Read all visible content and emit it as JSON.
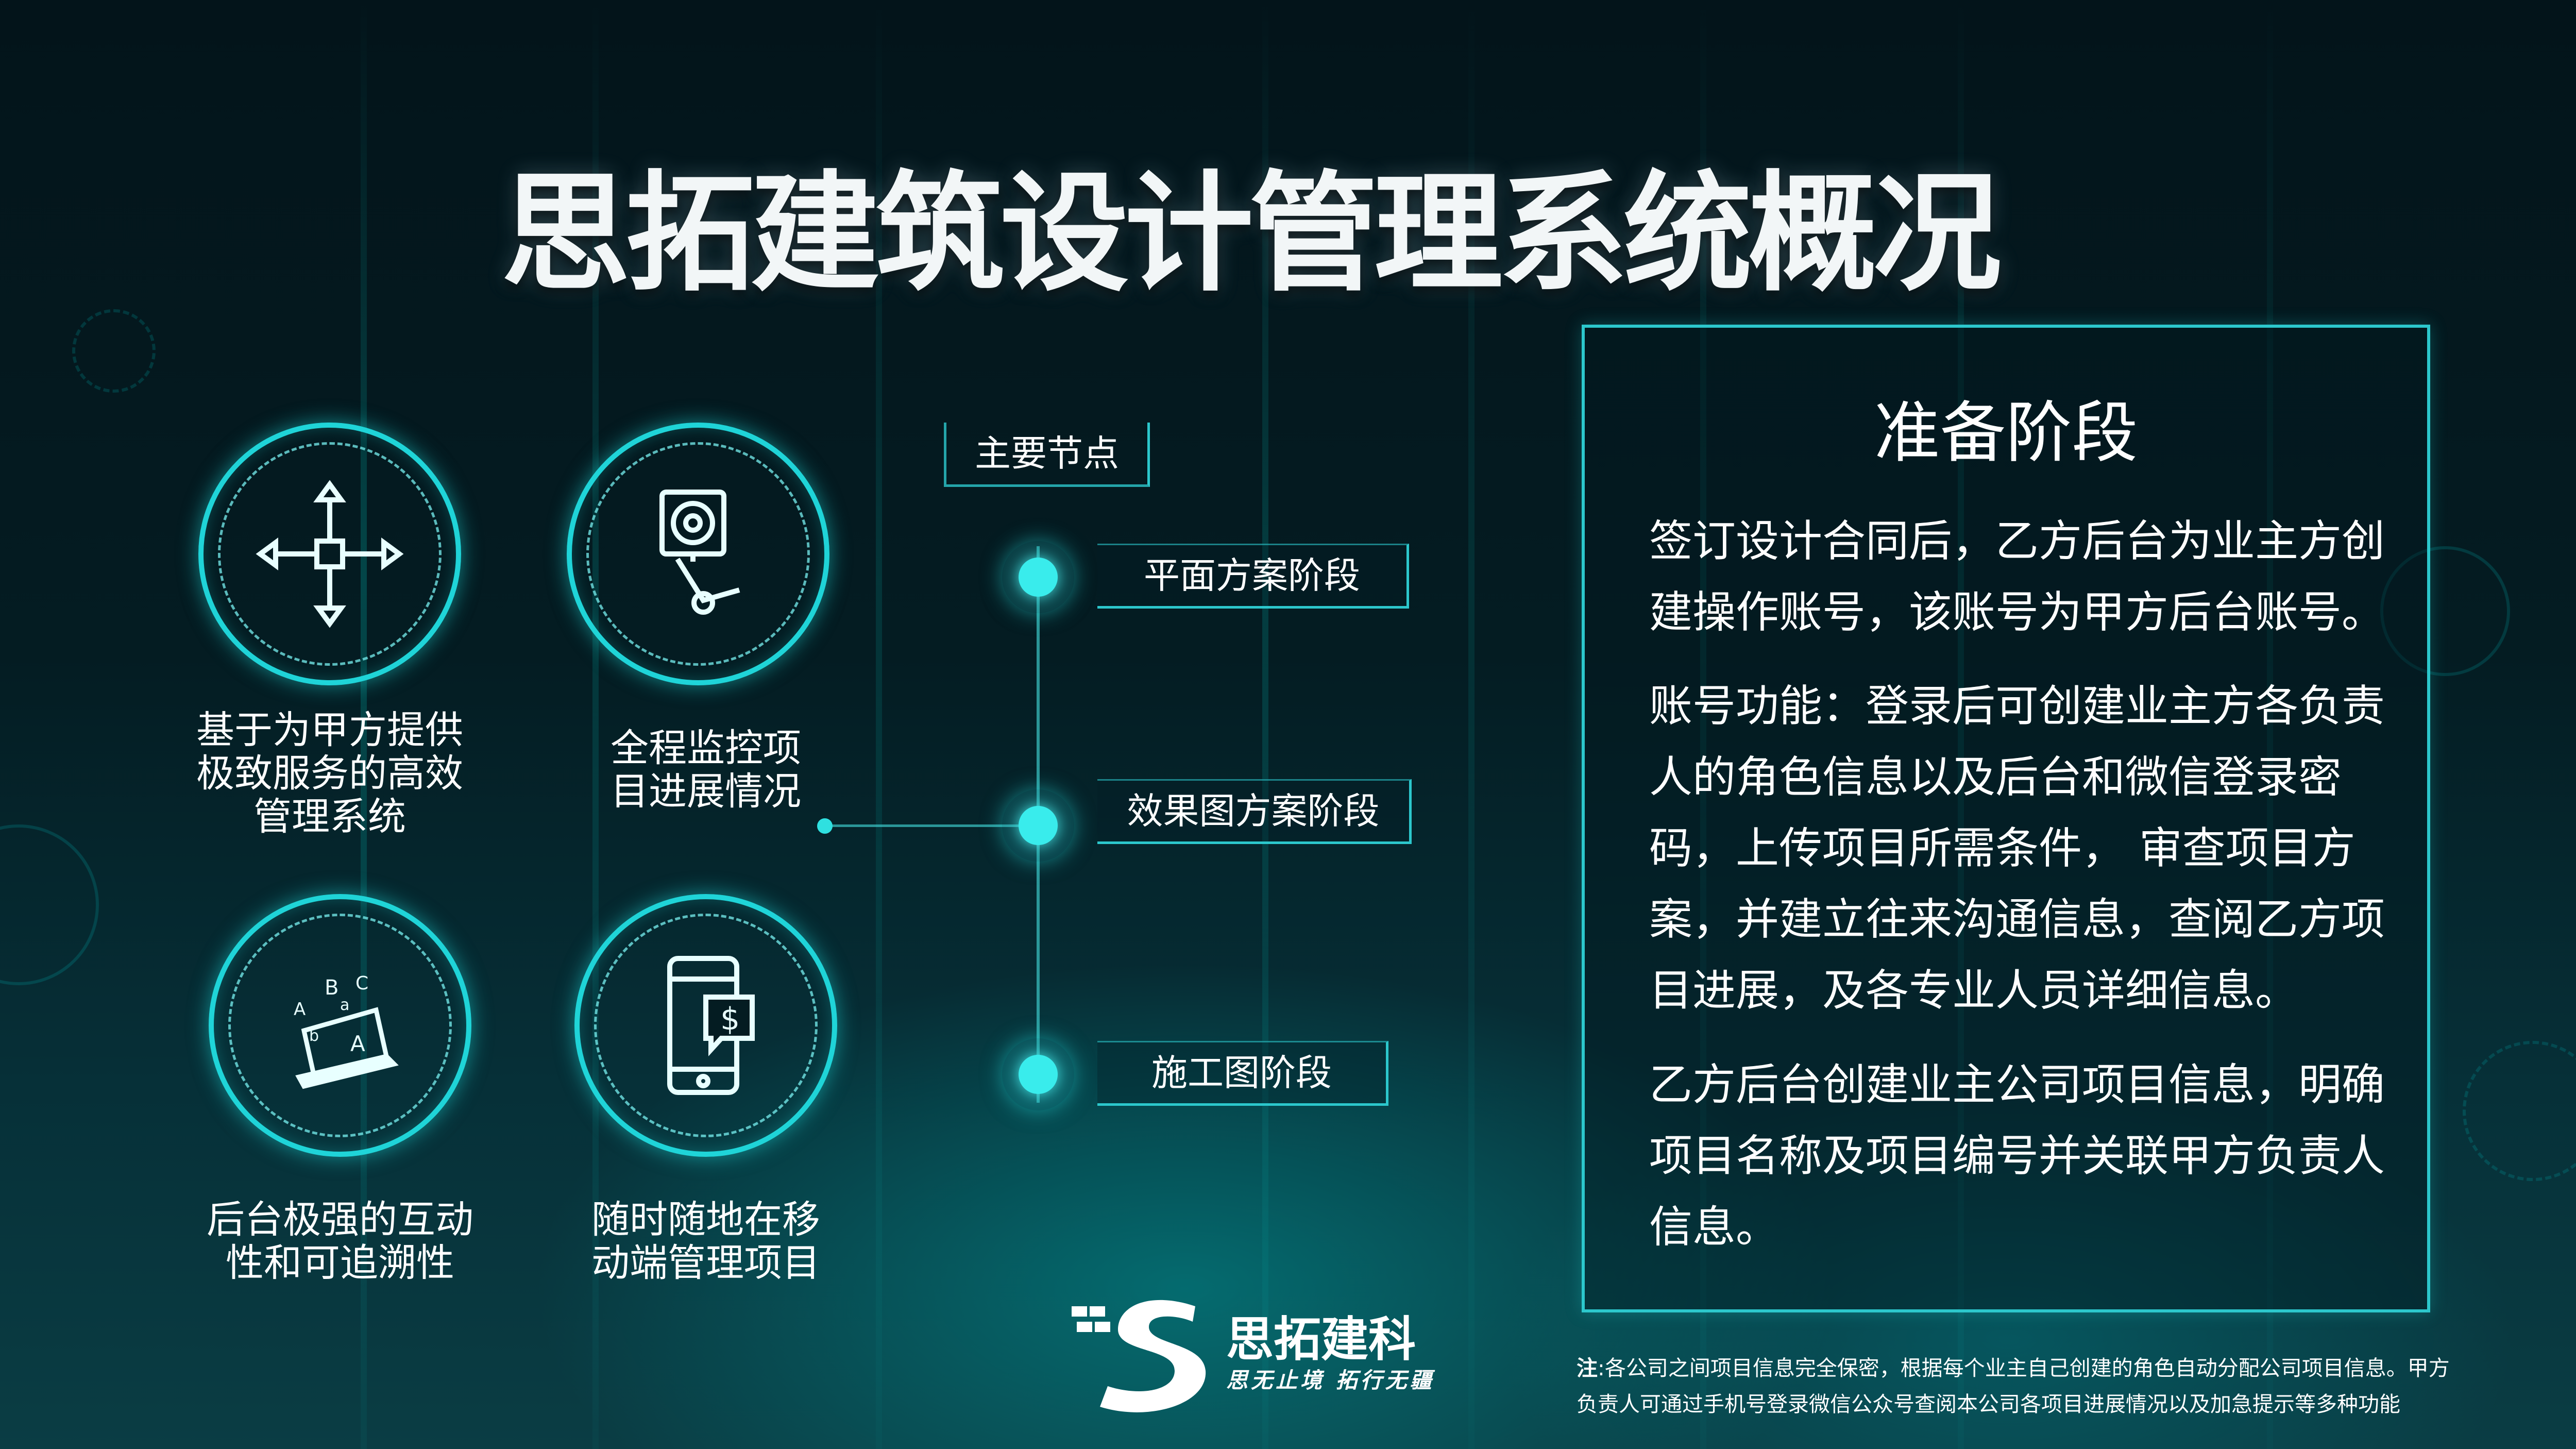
{
  "title": "思拓建筑设计管理系统概况",
  "features": [
    {
      "text": "基于为甲方提供\n极致服务的高效\n管理系统",
      "icon": "move-arrows-icon"
    },
    {
      "text": "全程监控项\n目进展情况",
      "icon": "monitor-camera-icon"
    },
    {
      "text": "后台极强的互动\n性和可追溯性",
      "icon": "laptop-letters-icon"
    },
    {
      "text": "随时随地在移\n动端管理项目",
      "icon": "mobile-dollar-icon"
    }
  ],
  "timeline": {
    "header": "主要节点",
    "nodes": [
      "平面方案阶段",
      "效果图方案阶段",
      "施工图阶段"
    ]
  },
  "panel": {
    "title": "准备阶段",
    "paragraphs": [
      "签订设计合同后，乙方后台为业主方创建操作账号，该账号为甲方后台账号。",
      "账号功能：登录后可创建业主方各负责人的角色信息以及后台和微信登录密码，上传项目所需条件， 审查项目方案，并建立往来沟通信息，查阅乙方项目进展，及各专业人员详细信息。",
      "乙方后台创建业主公司项目信息，明确项目名称及项目编号并关联甲方负责人信息。"
    ]
  },
  "brand": {
    "name": "思拓建科",
    "slogan": "思无止境 拓行无疆"
  },
  "note": {
    "label": "注",
    "text": ":各公司之间项目信息完全保密，根据每个业主自己创建的角色自动分配公司项目信息。甲方负责人可通过手机号登录微信公众号查阅本公司各项目进展情况以及加急提示等多种功能"
  },
  "colors": {
    "accent": "#2cc7cc",
    "node_glow": "#39ecec",
    "background": "#03141a"
  }
}
